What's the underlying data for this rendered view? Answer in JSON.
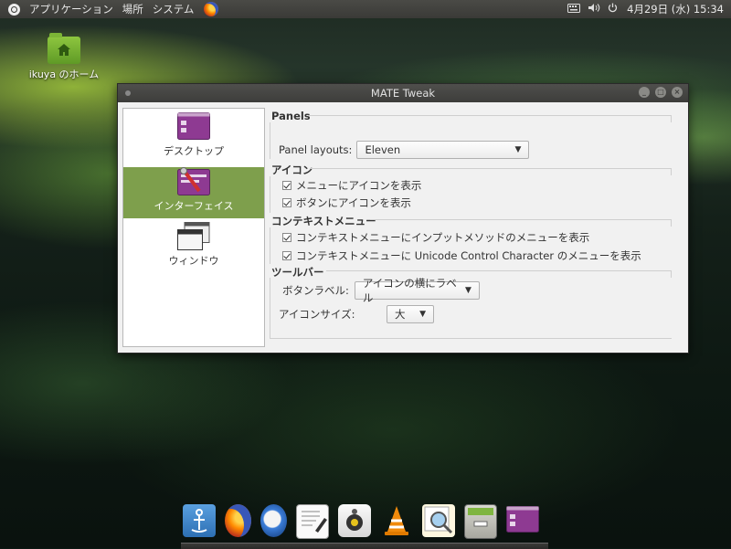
{
  "top_panel": {
    "menu_applications": "アプリケーション",
    "menu_places": "場所",
    "menu_system": "システム",
    "clock": "4月29日 (水) 15:34"
  },
  "desktop": {
    "home_label": "ikuya のホーム"
  },
  "window": {
    "title": "MATE Tweak",
    "sidebar": [
      {
        "label": "デスクトップ",
        "icon": "desktop-icon",
        "active": false
      },
      {
        "label": "インターフェイス",
        "icon": "interface-icon",
        "active": true
      },
      {
        "label": "ウィンドウ",
        "icon": "window-icon",
        "active": false
      }
    ],
    "panels": {
      "title": "Panels",
      "layouts_label": "Panel layouts:",
      "layouts_value": "Eleven"
    },
    "icons": {
      "title": "アイコン",
      "menu_icons": "メニューにアイコンを表示",
      "button_icons": "ボタンにアイコンを表示"
    },
    "context_menu": {
      "title": "コンテキストメニュー",
      "input_methods": "コンテキストメニューにインプットメソッドのメニューを表示",
      "unicode": "コンテキストメニューに Unicode Control Character のメニューを表示"
    },
    "toolbar": {
      "title": "ツールバー",
      "button_label_label": "ボタンラベル:",
      "button_label_value": "アイコンの横にラベル",
      "icon_size_label": "アイコンサイズ:",
      "icon_size_value": "大"
    }
  },
  "dock": {
    "items": [
      "anchor-icon",
      "firefox-icon",
      "thunderbird-icon",
      "text-editor-icon",
      "speaker-icon",
      "vlc-icon",
      "image-viewer-icon",
      "archive-icon",
      "mate-tweak-icon"
    ]
  },
  "colors": {
    "accent": "#7e9f4c",
    "panel": "#3d3d3b"
  }
}
